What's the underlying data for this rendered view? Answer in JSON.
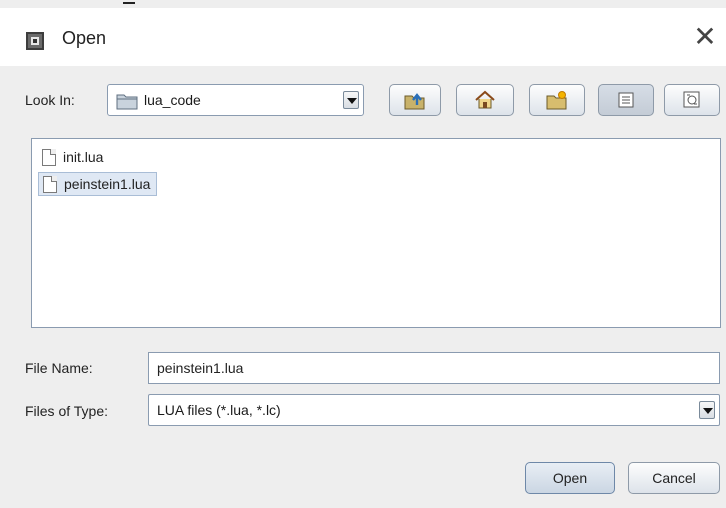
{
  "dialog": {
    "title": "Open",
    "close_glyph": "✕"
  },
  "look_in": {
    "label": "Look In:",
    "value": "lua_code"
  },
  "toolbar": {
    "buttons": [
      {
        "name": "up-folder-button",
        "icon": "up-one-level-icon"
      },
      {
        "name": "home-button",
        "icon": "home-icon"
      },
      {
        "name": "new-folder-button",
        "icon": "new-folder-icon"
      },
      {
        "name": "list-view-button",
        "icon": "list-view-icon",
        "pressed": true
      },
      {
        "name": "details-view-button",
        "icon": "details-view-icon"
      }
    ]
  },
  "files": [
    {
      "name": "init.lua",
      "selected": false
    },
    {
      "name": "peinstein1.lua",
      "selected": true
    }
  ],
  "file_name": {
    "label": "File Name:",
    "value": "peinstein1.lua"
  },
  "file_type": {
    "label": "Files of Type:",
    "value": "LUA files (*.lua, *.lc)"
  },
  "actions": {
    "open_label": "Open",
    "cancel_label": "Cancel"
  },
  "colors": {
    "selection": "#dfe8f4",
    "border": "#8a9bb0",
    "window_bg": "#eeeeee"
  }
}
